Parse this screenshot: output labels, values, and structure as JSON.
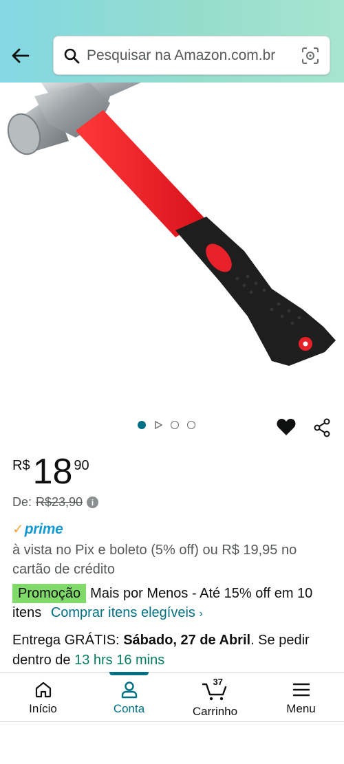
{
  "header": {
    "back_icon": "arrow-left-icon",
    "search_placeholder": "Pesquisar na Amazon.com.br",
    "search_icon": "search-icon",
    "camera_icon": "camera-scan-icon"
  },
  "product": {
    "image_description": "hammer-image",
    "carousel": {
      "total": 4,
      "active_index": 0
    },
    "price": {
      "currency": "R$",
      "whole": "18",
      "fraction": "90"
    },
    "was_price": {
      "label": "De:",
      "value": "R$23,90"
    },
    "prime_check": "✓",
    "prime_label": "prime",
    "pix_text": "à vista no Pix e boleto (5% off) ou R$ 19,95 no cartão de crédito",
    "promo": {
      "badge": "Promoção",
      "text": "Mais por Menos - Até 15% off em 10 itens",
      "link": "Comprar itens elegíveis",
      "chevron": "›"
    },
    "delivery": {
      "prefix": "Entrega GRÁTIS:",
      "date": "Sábado, 27 de Abril",
      "middle": ". Se pedir dentro de",
      "countdown": "13 hrs 16 mins"
    }
  },
  "bottom_nav": {
    "items": [
      {
        "label": "Início",
        "icon": "home-icon"
      },
      {
        "label": "Conta",
        "icon": "account-icon"
      },
      {
        "label": "Carrinho",
        "icon": "cart-icon",
        "count": "37"
      },
      {
        "label": "Menu",
        "icon": "menu-icon"
      }
    ],
    "active_index": 1
  },
  "colors": {
    "link": "#007185",
    "promo_badge": "#7fda69",
    "prime_blue": "#1399d2",
    "prime_check": "#f3a847",
    "countdown_green": "#067d62"
  }
}
